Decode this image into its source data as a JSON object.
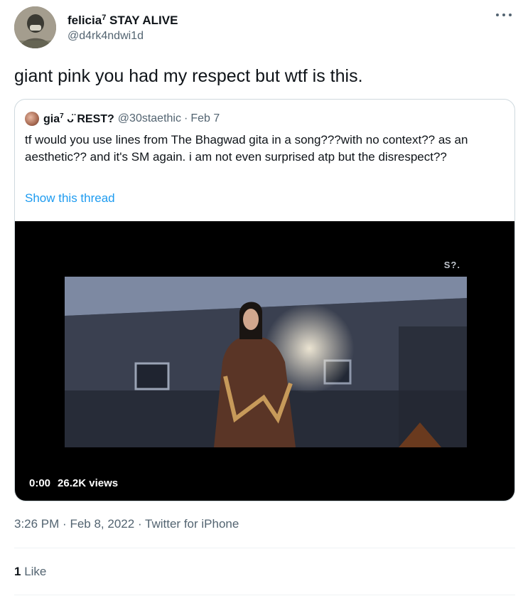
{
  "author": {
    "display_name": "felicia",
    "name_superscript": "7",
    "name_suffix": " STAY ALIVE",
    "handle": "@d4rk4ndwi1d"
  },
  "tweet": {
    "text": "giant pink you had my respect but wtf is this."
  },
  "quoted": {
    "display_name": "gia",
    "name_superscript": "7",
    "name_suffix": " ᴗ̈ REST?",
    "handle": "@30staethic",
    "separator": "·",
    "date": "Feb 7",
    "text": "tf would you use lines from The Bhagwad gita in a song???with no context?? as an aesthetic?? and it's  SM again. i am not even surprised atp but the disrespect??",
    "show_thread": "Show this thread",
    "media": {
      "watermark": "S?.",
      "time": "0:00",
      "views": "26.2K views"
    }
  },
  "meta": {
    "time": "3:26 PM",
    "sep1": "·",
    "date": "Feb 8, 2022",
    "sep2": "·",
    "source": "Twitter for iPhone"
  },
  "stats": {
    "like_count": "1",
    "like_label": "Like"
  },
  "icons": {
    "more": "more-horizontal-icon"
  },
  "colors": {
    "link": "#1d9bf0",
    "secondary_text": "#536471",
    "border": "#cfd9de"
  }
}
